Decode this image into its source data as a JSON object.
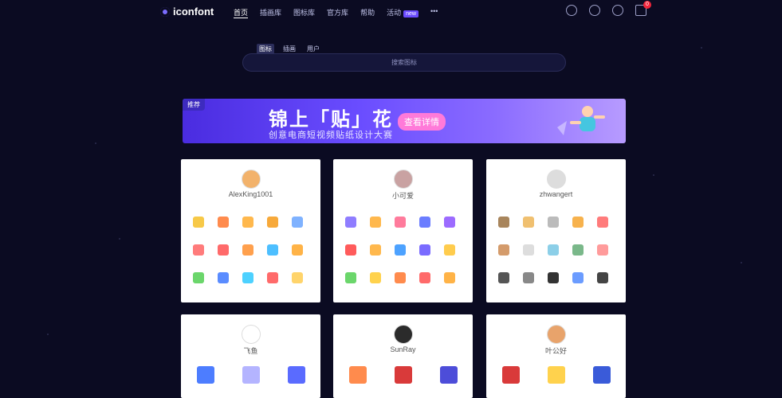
{
  "header": {
    "logo_text": "iconfont",
    "nav": [
      {
        "label": "首页",
        "active": true
      },
      {
        "label": "插画库",
        "active": false
      },
      {
        "label": "图标库",
        "active": false
      },
      {
        "label": "官方库",
        "active": false
      },
      {
        "label": "帮助",
        "active": false
      },
      {
        "label": "活动",
        "active": false
      }
    ],
    "new_badge": "new",
    "more": "•••",
    "cart_count": "0"
  },
  "search": {
    "tabs": [
      "图标",
      "插画",
      "用户"
    ],
    "placeholder": "搜索图标"
  },
  "banner": {
    "tag": "推荐",
    "title": "锦上「贴」花",
    "subtitle": "创意电商短视频贴纸设计大赛",
    "cta": "查看详情"
  },
  "cards": [
    {
      "user": "AlexKing1001",
      "avatar_color": "#f2b26b",
      "icons": [
        "#f7c948",
        "#ff8b4d",
        "#ffb84d",
        "#f7a93a",
        "#7fb2ff",
        "#ff7b7b",
        "#ff6a6a",
        "#ffa04d",
        "#4dbfff",
        "#ffb347",
        "#6bd66b",
        "#5a8cff",
        "#4dd1ff",
        "#ff6a6a",
        "#ffd46b"
      ]
    },
    {
      "user": "小可爱",
      "avatar_color": "#c9a2a2",
      "icons": [
        "#8f7dff",
        "#ffb84d",
        "#ff7b9c",
        "#6b7dff",
        "#9c6bff",
        "#ff5b5b",
        "#ffb84d",
        "#4da2ff",
        "#7a6bff",
        "#ffcc4d",
        "#6bd66b",
        "#ffd24d",
        "#ff8b4d",
        "#ff6a6a",
        "#ffb347"
      ]
    },
    {
      "user": "zhwangert",
      "avatar_color": "#dddddd",
      "icons": [
        "#a8855c",
        "#f0c070",
        "#bbbbbb",
        "#f7b24d",
        "#ff7b7b",
        "#d49b6b",
        "#dddddd",
        "#8ccfe8",
        "#7ab88a",
        "#ff9b9b",
        "#555555",
        "#888888",
        "#333333",
        "#6b9cff",
        "#444444"
      ]
    },
    {
      "user": "飞鱼",
      "avatar_color": "#ffffff",
      "icons": [
        "#4d7dff",
        "#b4b4ff",
        "#5a6bff"
      ]
    },
    {
      "user": "SunRay",
      "avatar_color": "#2b2b2b",
      "icons": [
        "#ff8b4d",
        "#d93a3a",
        "#4d4dd9"
      ]
    },
    {
      "user": "叶公好",
      "avatar_color": "#e8a36b",
      "icons": [
        "#d93a3a",
        "#ffd24d",
        "#3a5bd9"
      ]
    }
  ]
}
